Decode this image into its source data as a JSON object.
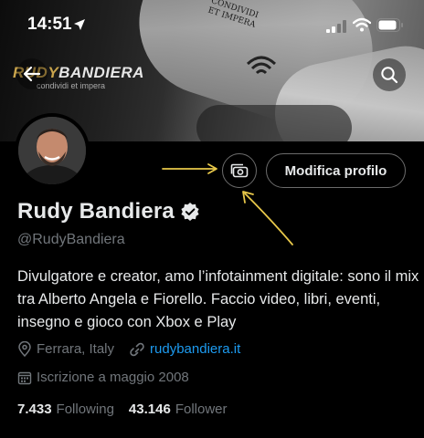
{
  "status_bar": {
    "time": "14:51"
  },
  "banner": {
    "brand_prefix": "RUDY",
    "brand_suffix": "BANDIERA",
    "brand_tagline": "condividi et impera",
    "tattoo_text": "CONDIVIDI ET IMPERA"
  },
  "actions": {
    "edit_profile_label": "Modifica profilo"
  },
  "profile": {
    "display_name": "Rudy Bandiera",
    "handle": "@RudyBandiera",
    "bio": "Divulgatore e creator, amo l’infotainment digitale: sono il mix tra Alberto Angela e Fiorello. Faccio video, libri, eventi, insegno e gioco con Xbox e Play",
    "location": "Ferrara, Italy",
    "website": "rudybandiera.it",
    "joined": "Iscrizione a maggio 2008",
    "following_count": "7.433",
    "following_label": "Following",
    "followers_count": "43.146",
    "followers_label": "Follower"
  },
  "colors": {
    "background": "#000000",
    "link": "#1d9bf0",
    "muted_text": "#71767b",
    "annotation": "#e8c84a"
  },
  "icons": [
    "location-arrow-icon",
    "signal-icon",
    "wifi-icon",
    "battery-icon",
    "back-arrow-icon",
    "search-icon",
    "camera-icon",
    "verified-badge-icon",
    "location-pin-icon",
    "link-icon",
    "calendar-icon"
  ]
}
